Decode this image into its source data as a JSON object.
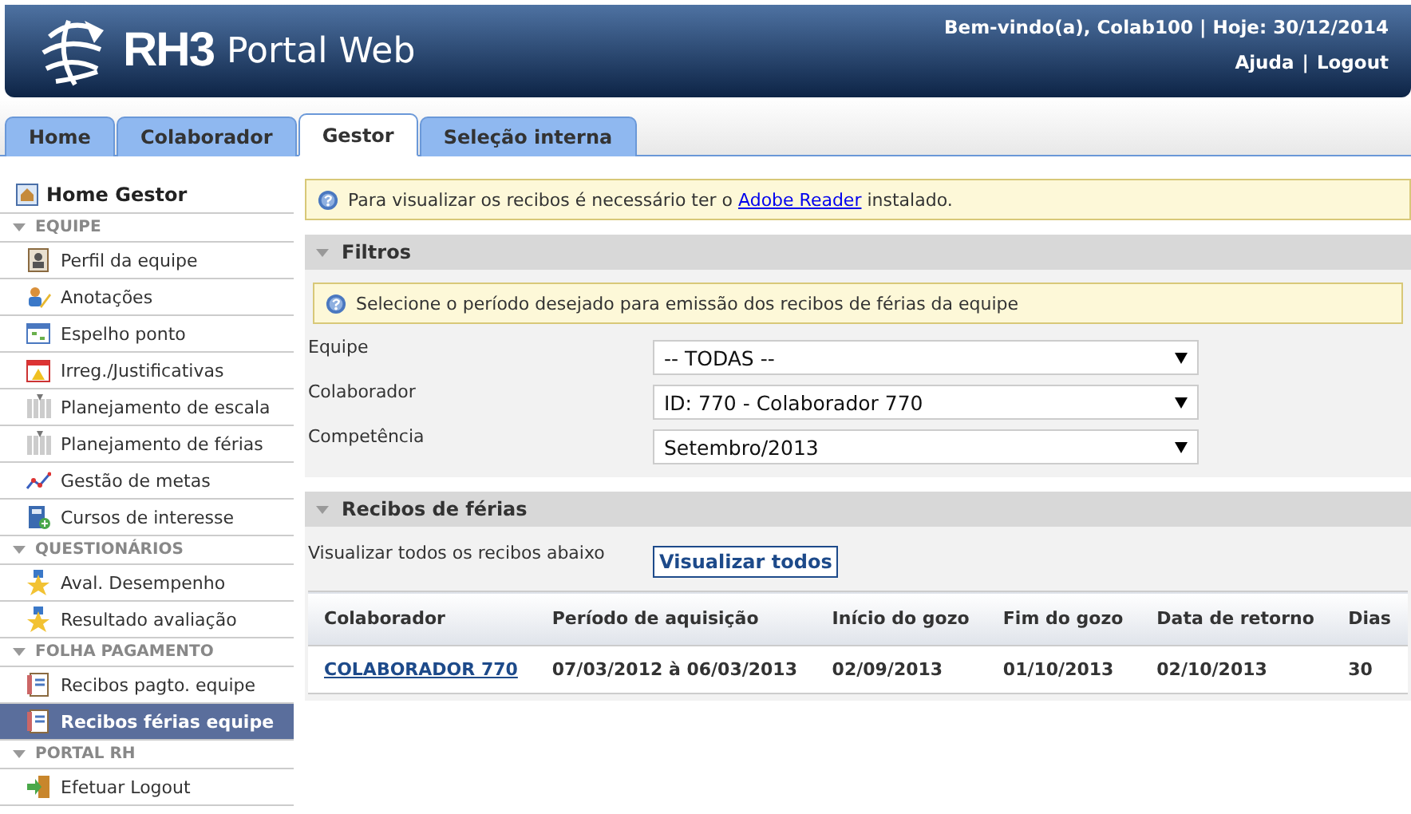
{
  "header": {
    "logo_mark": "RH3",
    "logo_text": "Portal Web",
    "welcome": "Bem-vindo(a), Colab100 | Hoje: 30/12/2014",
    "links": [
      "Ajuda",
      "Logout"
    ],
    "links_separator": "|"
  },
  "tabs": [
    {
      "label": "Home",
      "selected": false
    },
    {
      "label": "Colaborador",
      "selected": false
    },
    {
      "label": "Gestor",
      "selected": true
    },
    {
      "label": "Seleção interna",
      "selected": false
    }
  ],
  "sidebar": {
    "home": "Home Gestor",
    "sections": [
      {
        "title": "EQUIPE",
        "items": [
          {
            "label": "Perfil da equipe",
            "selected": false
          },
          {
            "label": "Anotações",
            "selected": false
          },
          {
            "label": "Espelho ponto",
            "selected": false
          },
          {
            "label": "Irreg./Justificativas",
            "selected": false
          },
          {
            "label": "Planejamento de escala",
            "selected": false
          },
          {
            "label": "Planejamento de férias",
            "selected": false
          },
          {
            "label": "Gestão de metas",
            "selected": false
          },
          {
            "label": "Cursos de interesse",
            "selected": false
          }
        ]
      },
      {
        "title": "QUESTIONÁRIOS",
        "items": [
          {
            "label": "Aval. Desempenho",
            "selected": false
          },
          {
            "label": "Resultado avaliação",
            "selected": false
          }
        ]
      },
      {
        "title": "FOLHA PAGAMENTO",
        "items": [
          {
            "label": "Recibos pagto. equipe",
            "selected": false
          },
          {
            "label": "Recibos férias equipe",
            "selected": true
          }
        ]
      },
      {
        "title": "PORTAL RH",
        "items": [
          {
            "label": "Efetuar Logout",
            "selected": false
          }
        ]
      }
    ]
  },
  "notice": {
    "before": "Para visualizar os recibos é necessário ter o",
    "link": "Adobe Reader",
    "after": "instalado."
  },
  "filters": {
    "title": "Filtros",
    "hint": "Selecione o período desejado para emissão dos recibos de férias da equipe",
    "fields": [
      {
        "label": "Equipe",
        "value": "-- TODAS --"
      },
      {
        "label": "Colaborador",
        "value": "ID: 770 - Colaborador 770"
      },
      {
        "label": "Competência",
        "value": "Setembro/2013"
      }
    ]
  },
  "receipts": {
    "title": "Recibos de férias",
    "view_all_text": "Visualizar todos os recibos abaixo",
    "view_all_button": "Visualizar todos",
    "columns": [
      "Colaborador",
      "Período de aquisição",
      "Início do gozo",
      "Fim do gozo",
      "Data de retorno",
      "Dias"
    ],
    "rows": [
      [
        "COLABORADOR 770",
        "07/03/2012 à 06/03/2013",
        "02/09/2013",
        "01/10/2013",
        "02/10/2013",
        "30"
      ]
    ]
  }
}
